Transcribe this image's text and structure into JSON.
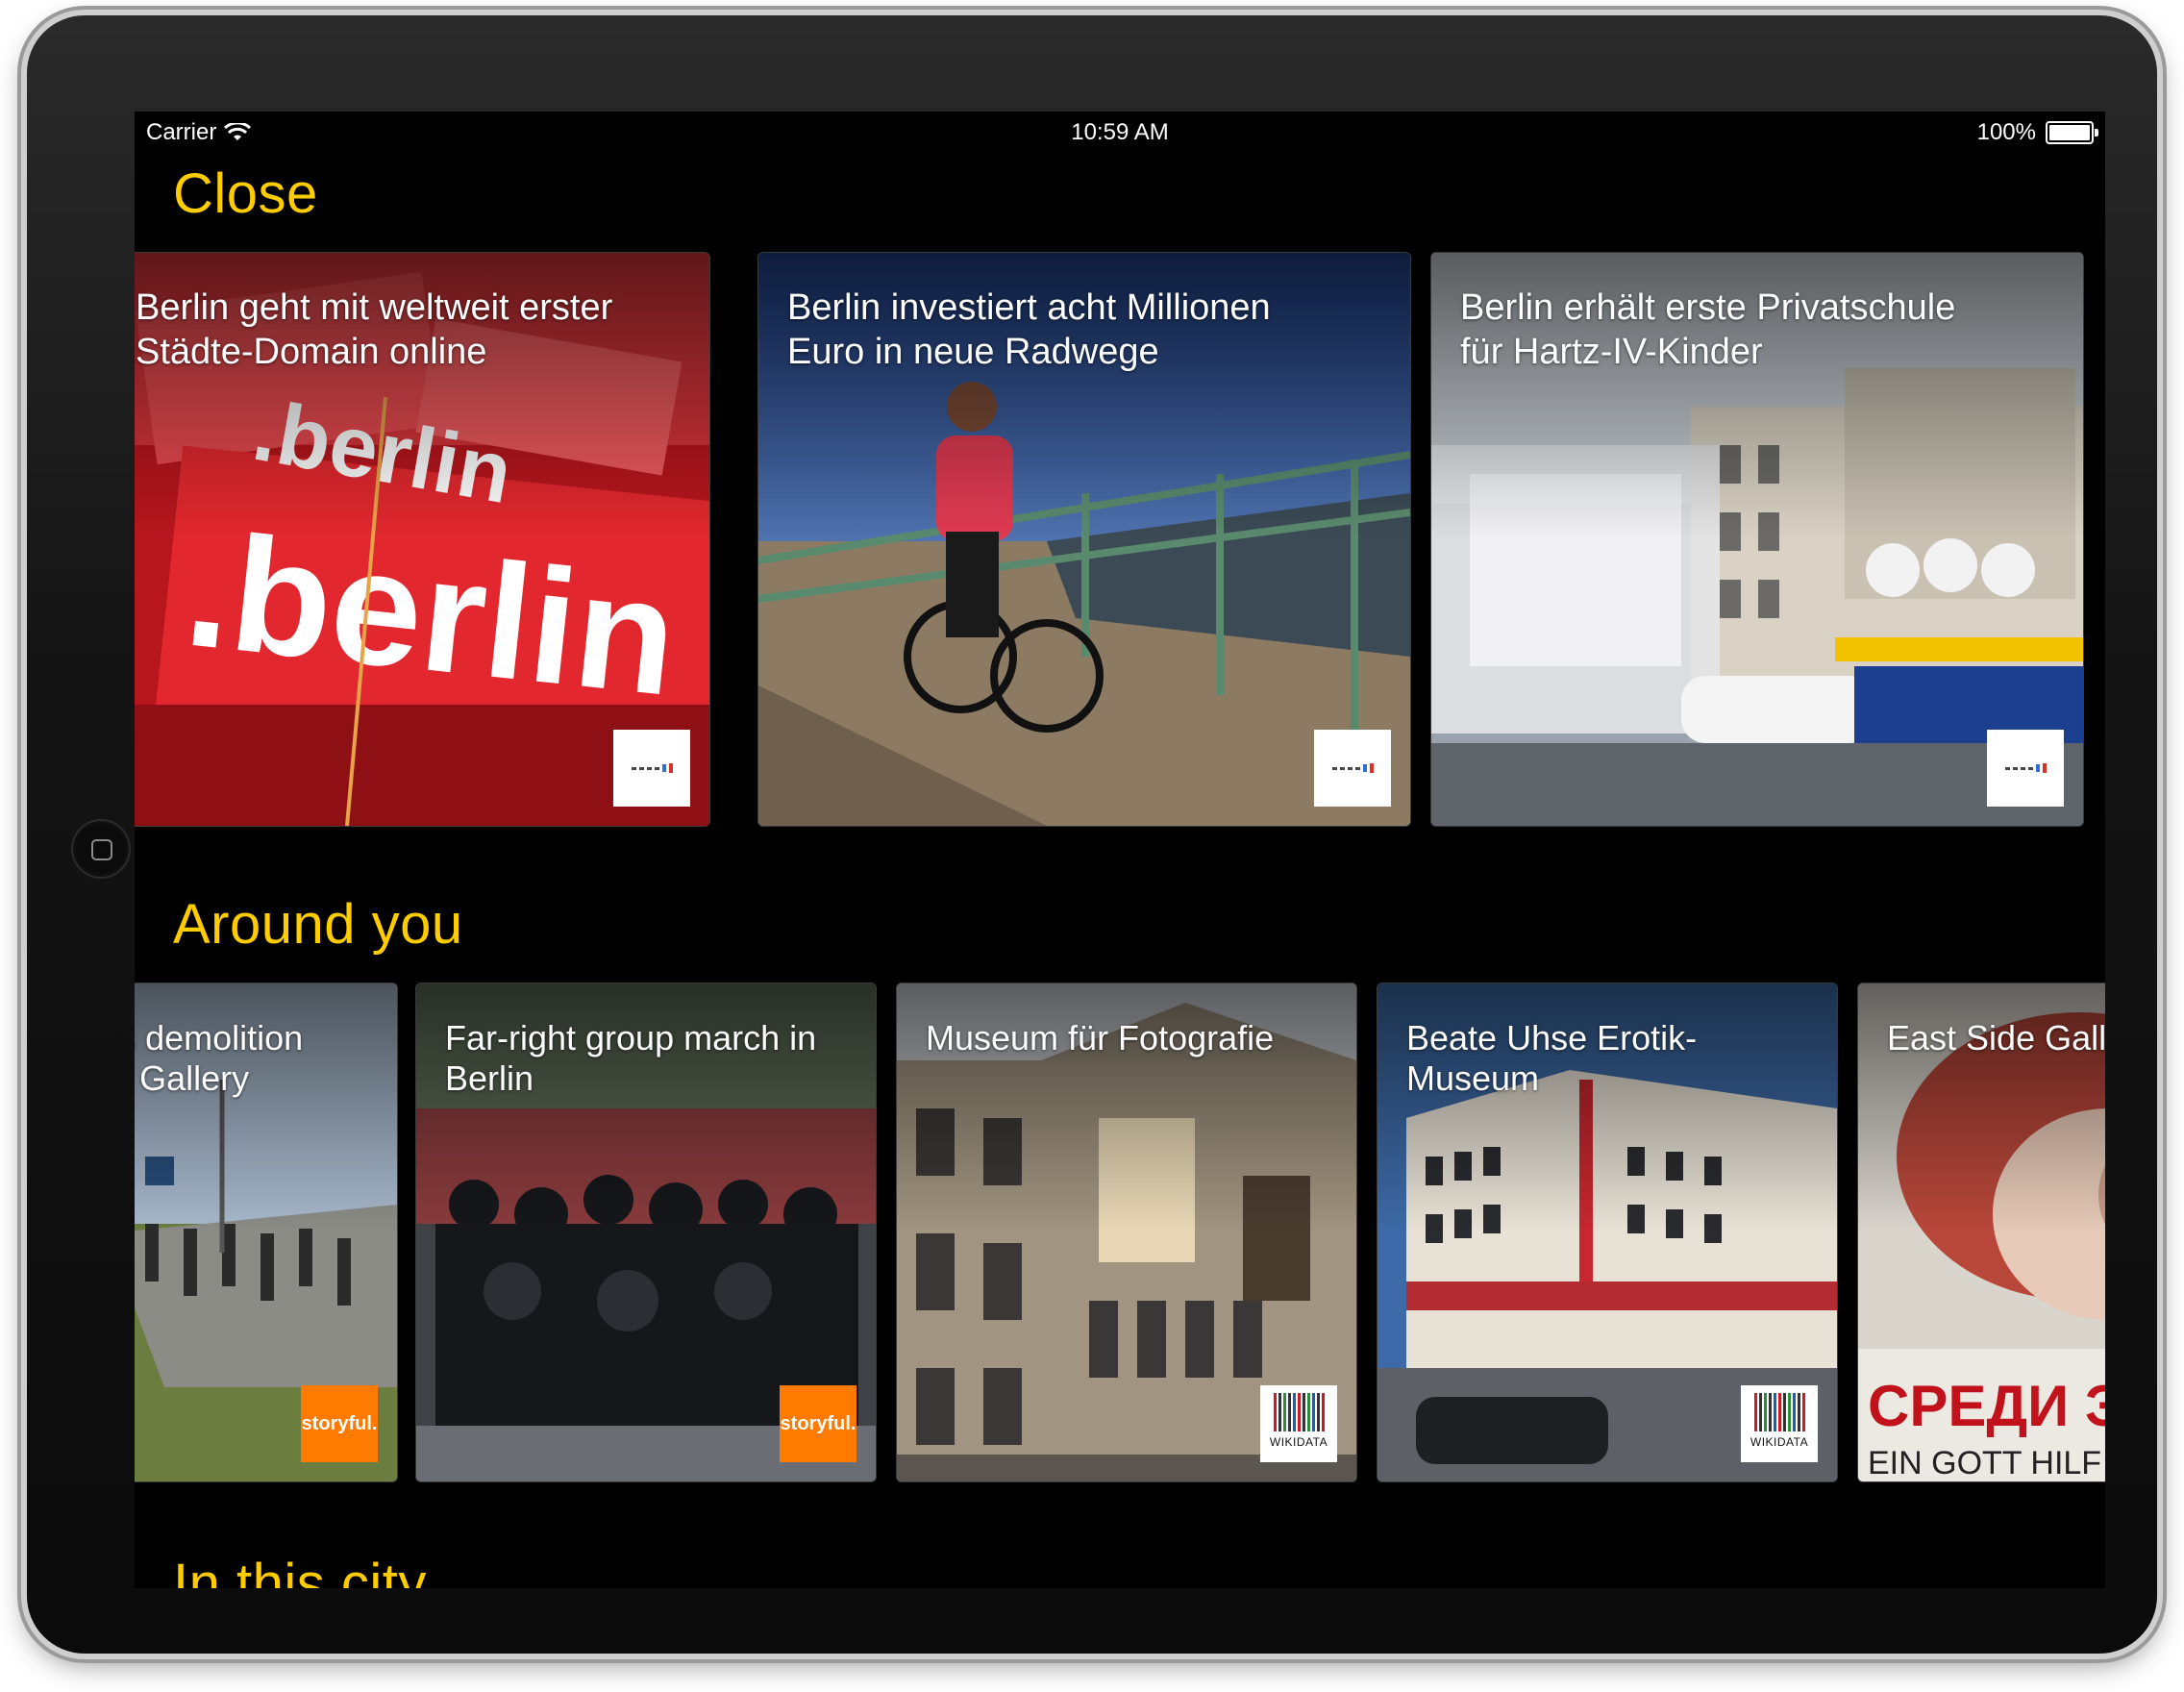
{
  "status_bar": {
    "carrier": "Carrier",
    "time": "10:59 AM",
    "battery": "100%"
  },
  "sections": {
    "close": {
      "title": "Close",
      "cards": [
        {
          "title": "Berlin geht mit weltweit erster\nStädte-Domain online",
          "photo_icon": "berlin-domain-photo",
          "source_badge": "logo-badge"
        },
        {
          "title": "Berlin investiert acht Millionen\nEuro in neue Radwege",
          "photo_icon": "cyclist-photo",
          "source_badge": "logo-badge"
        },
        {
          "title": "Berlin erhält erste Privatschule\nfür Hartz-IV-Kinder",
          "photo_icon": "street-truck-photo",
          "source_badge": "logo-badge"
        }
      ]
    },
    "around_you": {
      "title": "Around you",
      "cards": [
        {
          "title": "Protest halts demolition\nof East Side Gallery",
          "photo_icon": "crowd-walkway-photo",
          "source_badge": "storyful"
        },
        {
          "title": "Far-right group march in\nBerlin",
          "photo_icon": "police-march-photo",
          "source_badge": "storyful"
        },
        {
          "title": "Museum für Fotografie",
          "photo_icon": "museum-building-photo",
          "source_badge": "wikidata"
        },
        {
          "title": "Beate Uhse Erotik-\nMuseum",
          "photo_icon": "office-building-photo",
          "source_badge": "wikidata"
        },
        {
          "title": "East Side Gallery",
          "photo_icon": "mural-photo",
          "source_badge": "wikidata"
        }
      ]
    },
    "in_this_city": {
      "title": "In this city"
    }
  },
  "badges": {
    "storyful_label": "storyful.",
    "wikidata_label": "WIKIDATA"
  },
  "colors": {
    "accent": "#ffcc00",
    "background": "#000000",
    "storyful": "#ff7a00"
  }
}
